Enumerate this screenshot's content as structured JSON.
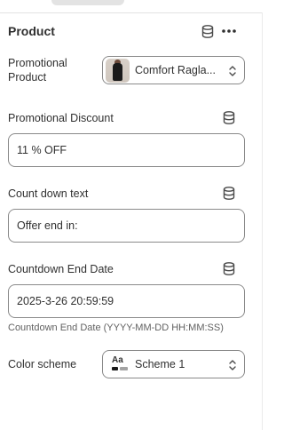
{
  "section": {
    "title": "Product",
    "icons": {
      "dynamic_source": "database-icon",
      "more": "more-horizontal-icon"
    }
  },
  "fields": {
    "promotional_product": {
      "label": "Promotional Product",
      "value": "Comfort Ragla..."
    },
    "promotional_discount": {
      "label": "Promotional Discount",
      "value": "11 % OFF"
    },
    "countdown_text": {
      "label": "Count down text",
      "value": "Offer end in:"
    },
    "countdown_end_date": {
      "label": "Countdown End Date",
      "value": "2025-3-26 20:59:59",
      "help": "Countdown End Date (YYYY-MM-DD HH:MM:SS)"
    },
    "color_scheme": {
      "label": "Color scheme",
      "value": "Scheme 1",
      "icon_text": "Aa"
    }
  },
  "colors": {
    "text": "#303030",
    "border": "#8a8a8a",
    "muted": "#616161",
    "icon": "#4a4a4a"
  }
}
